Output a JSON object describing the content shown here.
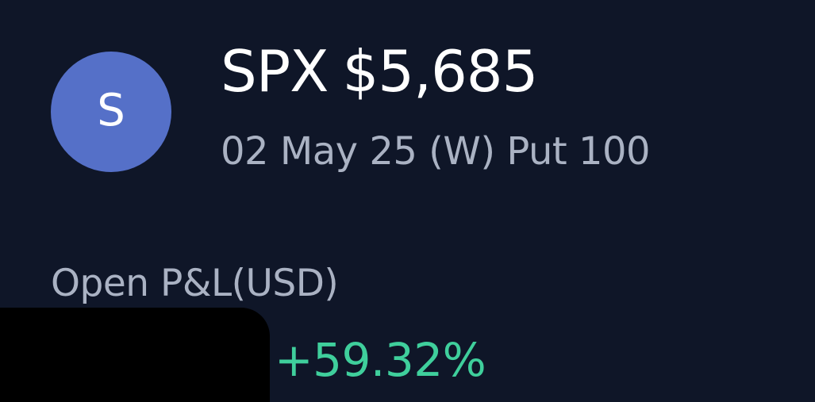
{
  "position": {
    "avatar_letter": "S",
    "symbol": "SPX",
    "price": "$5,685",
    "contract": "02 May 25 (W) Put 100"
  },
  "pnl": {
    "label": "Open P&L(USD)",
    "percent": "+59.32%"
  },
  "colors": {
    "background": "#0f1628",
    "avatar": "#5570c8",
    "gain": "#3fcf9c",
    "secondary_text": "#aab2c3"
  }
}
